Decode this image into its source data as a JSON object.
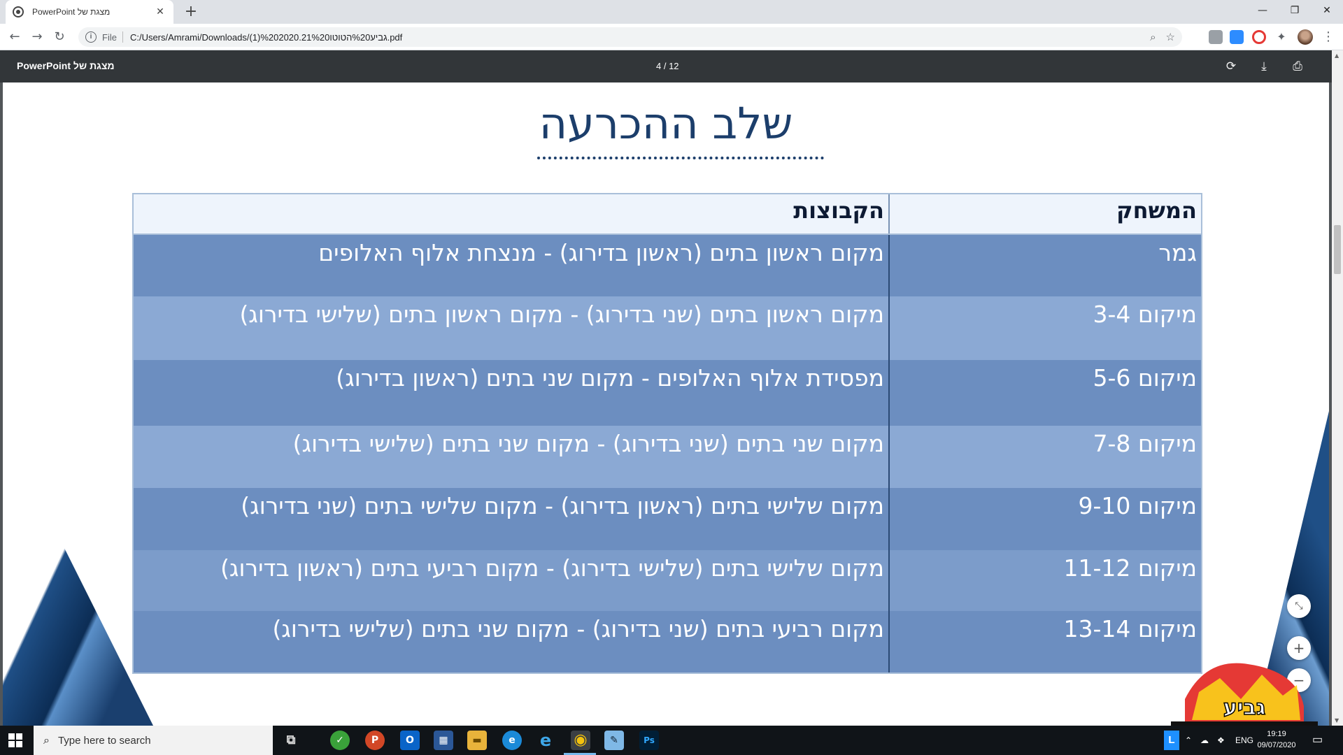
{
  "browser": {
    "tab_title": "PowerPoint מצגת של",
    "tab_close": "✕",
    "new_tab": "+",
    "window_controls": {
      "minimize": "—",
      "restore": "❐",
      "close": "✕"
    },
    "omnibox": {
      "info_icon": "i",
      "scheme_label": "File",
      "url": "C:/Users/Amrami/Downloads/(1)%202020.21%20גביע%20הטוטו.pdf"
    }
  },
  "pdf_viewer": {
    "doc_title": "PowerPoint מצגת של",
    "page_indicator": "4 / 12"
  },
  "slide": {
    "title": "שלב ההכרעה",
    "table": {
      "headers": {
        "game": "המשחק",
        "teams": "הקבוצות"
      },
      "rows": [
        {
          "game": "גמר",
          "teams": "מקום ראשון בתים (ראשון בדירוג) - מנצחת אלוף האלופים"
        },
        {
          "game": "מיקום 3-4",
          "teams": "מקום ראשון בתים (שני בדירוג) - מקום ראשון בתים (שלישי בדירוג)"
        },
        {
          "game": "מיקום 5-6",
          "teams": "מפסידת אלוף האלופים - מקום שני בתים (ראשון בדירוג)"
        },
        {
          "game": "מיקום 7-8",
          "teams": "מקום שני בתים (שני בדירוג) - מקום שני בתים (שלישי בדירוג)"
        },
        {
          "game": "מיקום 9-10",
          "teams": "מקום שלישי בתים (ראשון בדירוג) - מקום שלישי בתים (שני בדירוג)"
        },
        {
          "game": "מיקום 11-12",
          "teams": "מקום שלישי בתים (שלישי בדירוג) - מקום רביעי בתים (ראשון בדירוג)"
        },
        {
          "game": "מיקום 13-14",
          "teams": "מקום רביעי בתים (שני בדירוג) - מקום שני בתים (שלישי בדירוג)"
        }
      ]
    },
    "zoom_controls": {
      "fit": "⤡",
      "zoom_in": "+",
      "zoom_out": "−"
    },
    "logo_text": "גביע"
  },
  "taskbar": {
    "search_placeholder": "Type here to search",
    "apps": [
      {
        "name": "task-view",
        "glyph": "⧉"
      },
      {
        "name": "app-green",
        "glyph": "✓"
      },
      {
        "name": "powerpoint",
        "glyph": "P"
      },
      {
        "name": "outlook",
        "glyph": "O"
      },
      {
        "name": "calculator",
        "glyph": "▦"
      },
      {
        "name": "file-explorer",
        "glyph": "▬"
      },
      {
        "name": "edge",
        "glyph": "e"
      },
      {
        "name": "internet-explorer",
        "glyph": "e"
      },
      {
        "name": "chrome",
        "glyph": "◉"
      },
      {
        "name": "notes",
        "glyph": "✎"
      },
      {
        "name": "photoshop",
        "glyph": "Ps"
      }
    ],
    "tray": {
      "language": "ENG",
      "time": "19:19",
      "date": "09/07/2020"
    }
  },
  "colors": {
    "title_blue": "#1c3e6b",
    "row_dark": "#6c8ec0",
    "row_light": "#8ba9d4",
    "header_bg": "#eef4fc",
    "pdf_toolbar": "#323639"
  }
}
